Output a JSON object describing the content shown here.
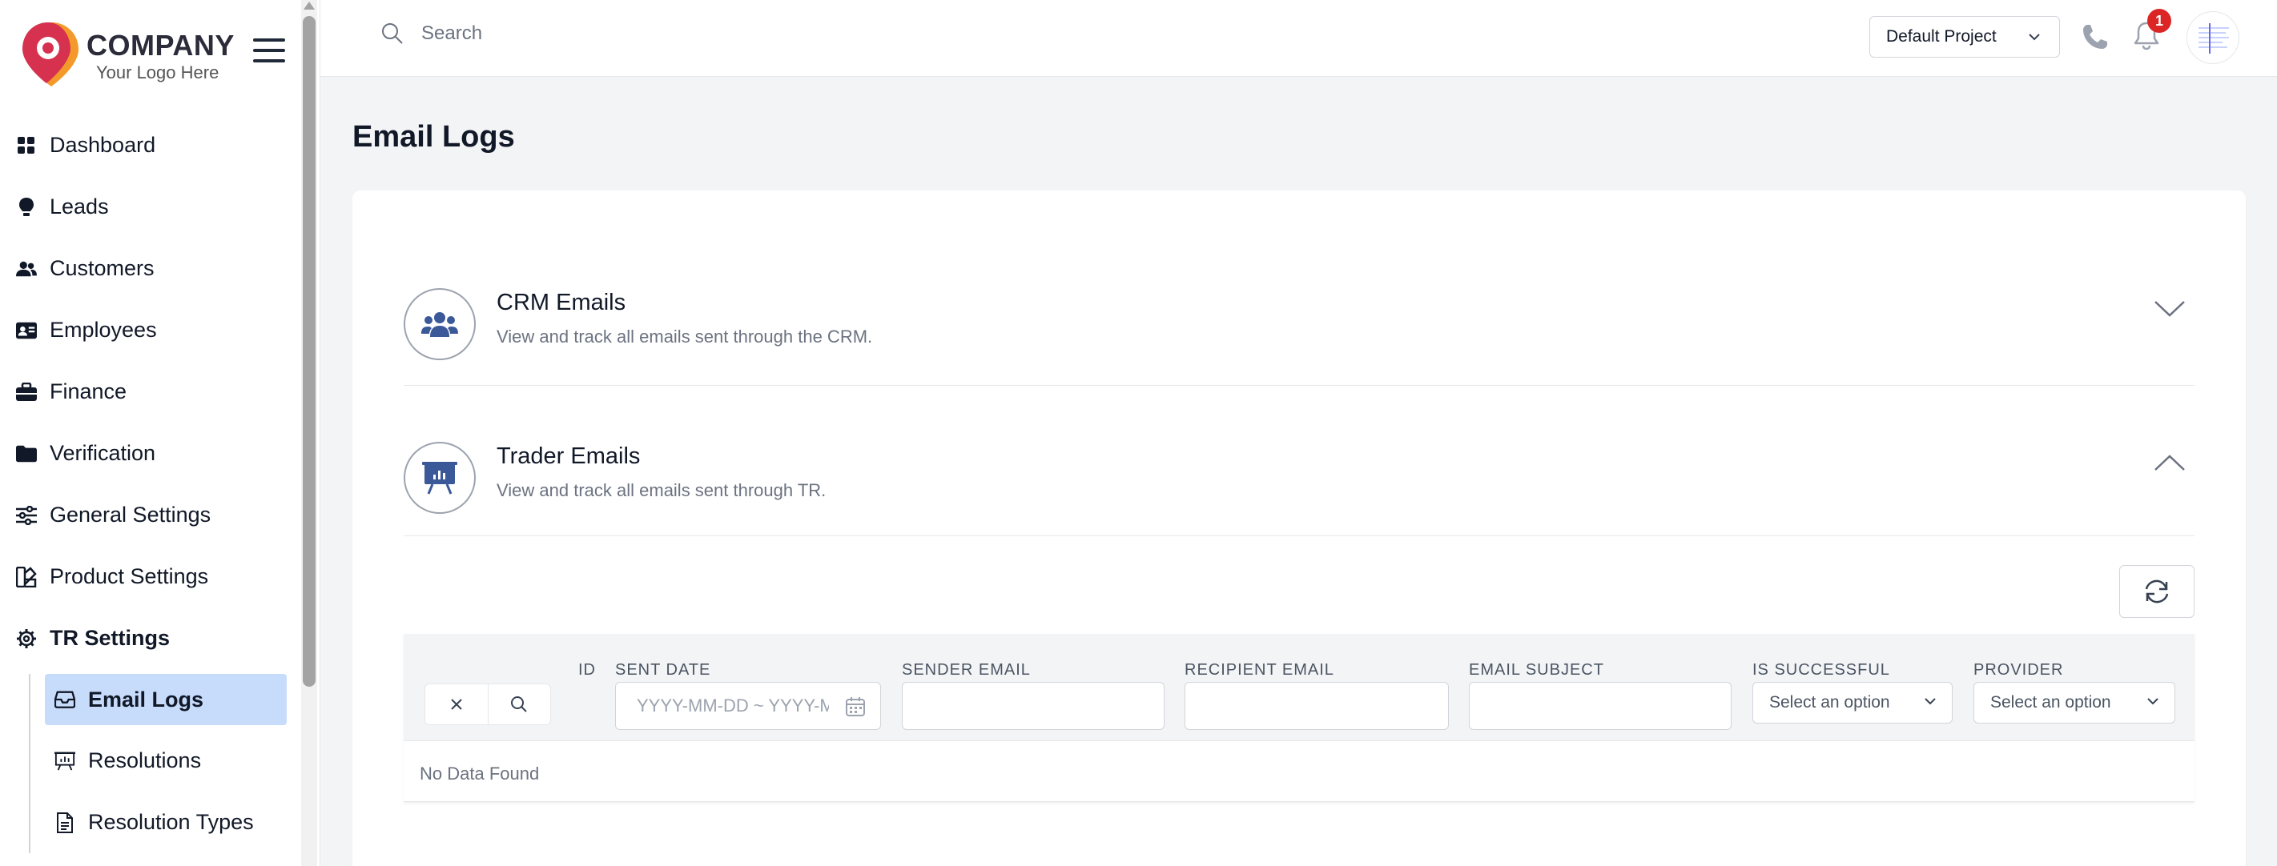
{
  "brand": {
    "name": "COMPANY",
    "tagline": "Your Logo Here",
    "accent": "#d6314f",
    "accent2": "#f39a2b"
  },
  "header": {
    "search_placeholder": "Search",
    "project": "Default Project",
    "notification_count": "1"
  },
  "sidebar": {
    "items": [
      {
        "label": "Dashboard",
        "icon": "dashboard-grid-icon"
      },
      {
        "label": "Leads",
        "icon": "lightbulb-icon"
      },
      {
        "label": "Customers",
        "icon": "users-icon"
      },
      {
        "label": "Employees",
        "icon": "id-card-icon"
      },
      {
        "label": "Finance",
        "icon": "briefcase-icon"
      },
      {
        "label": "Verification",
        "icon": "folder-icon"
      },
      {
        "label": "General Settings",
        "icon": "sliders-icon"
      },
      {
        "label": "Product Settings",
        "icon": "palette-icon"
      },
      {
        "label": "TR Settings",
        "icon": "gear-icon"
      }
    ],
    "subitems": [
      {
        "label": "Email Logs",
        "icon": "inbox-icon",
        "active": true
      },
      {
        "label": "Resolutions",
        "icon": "presentation-icon"
      },
      {
        "label": "Resolution Types",
        "icon": "document-icon"
      }
    ]
  },
  "page": {
    "title": "Email Logs"
  },
  "sections": {
    "crm": {
      "title": "CRM Emails",
      "description": "View and track all emails sent through the CRM."
    },
    "trader": {
      "title": "Trader Emails",
      "description": "View and track all emails sent through TR."
    }
  },
  "table": {
    "columns": {
      "id": "ID",
      "sent_date": "SENT DATE",
      "sender": "SENDER EMAIL",
      "recipient": "RECIPIENT EMAIL",
      "subject": "EMAIL SUBJECT",
      "successful": "IS SUCCESSFUL",
      "provider": "PROVIDER"
    },
    "date_placeholder": "YYYY-MM-DD ~ YYYY-MM-DD",
    "select_placeholder": "Select an option",
    "empty": "No Data Found"
  },
  "colors": {
    "primary": "#3b5998",
    "active_bg": "#c7dcfb"
  }
}
